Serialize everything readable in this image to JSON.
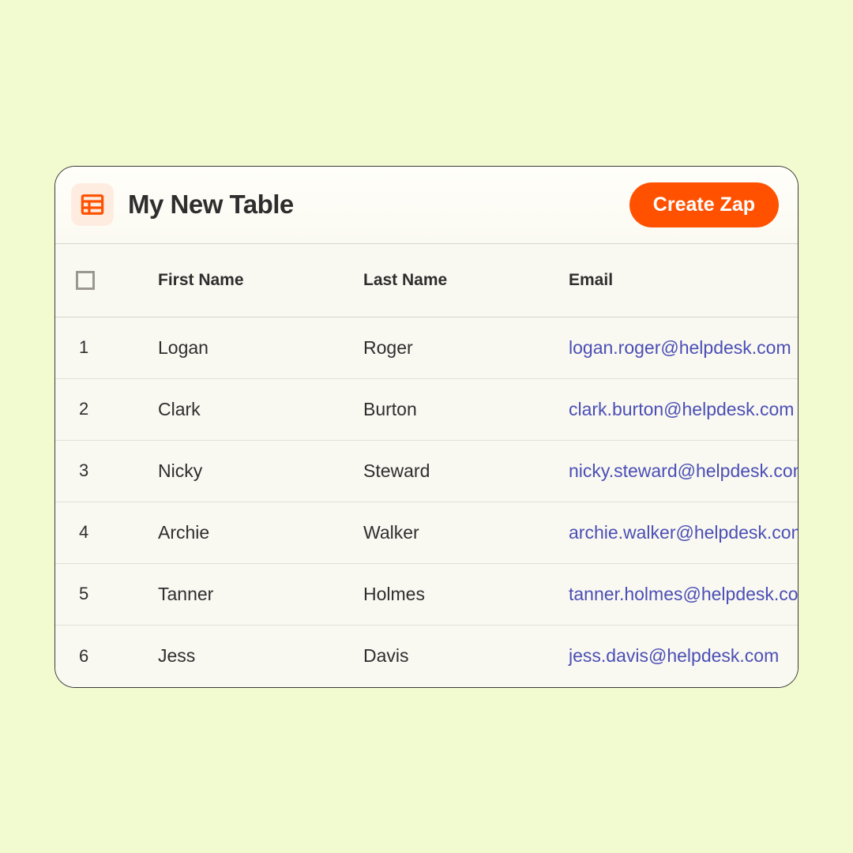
{
  "header": {
    "title": "My New Table",
    "create_button": "Create Zap"
  },
  "columns": {
    "first_name": "First Name",
    "last_name": "Last Name",
    "email": "Email"
  },
  "rows": [
    {
      "n": "1",
      "first": "Logan",
      "last": "Roger",
      "email": "logan.roger@helpdesk.com"
    },
    {
      "n": "2",
      "first": "Clark",
      "last": "Burton",
      "email": "clark.burton@helpdesk.com"
    },
    {
      "n": "3",
      "first": "Nicky",
      "last": "Steward",
      "email": "nicky.steward@helpdesk.com"
    },
    {
      "n": "4",
      "first": "Archie",
      "last": "Walker",
      "email": "archie.walker@helpdesk.com"
    },
    {
      "n": "5",
      "first": "Tanner",
      "last": "Holmes",
      "email": "tanner.holmes@helpdesk.com"
    },
    {
      "n": "6",
      "first": "Jess",
      "last": "Davis",
      "email": "jess.davis@helpdesk.com"
    }
  ]
}
